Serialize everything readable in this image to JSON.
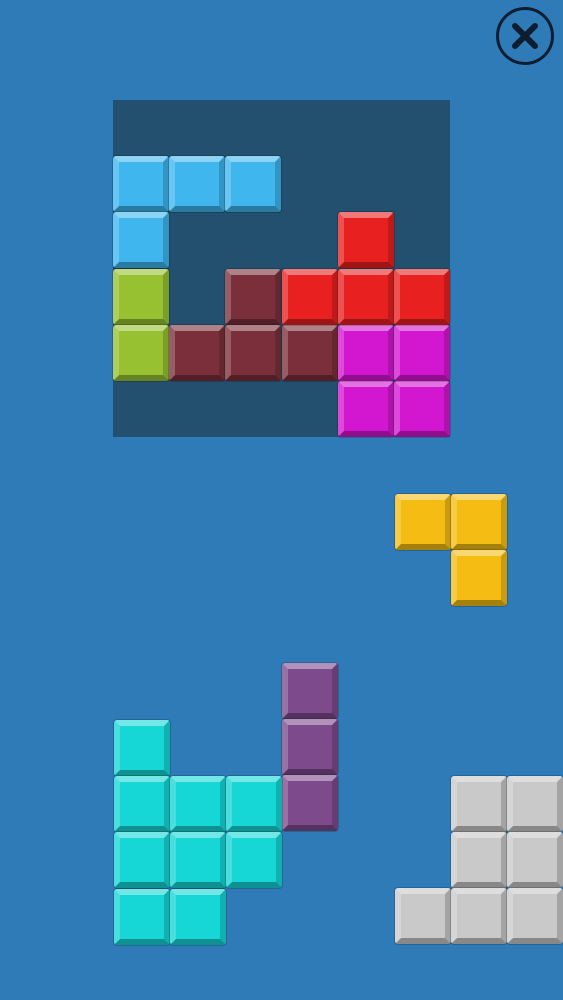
{
  "header": {
    "close_icon": "close-icon"
  },
  "board": {
    "columns": 6,
    "rows": 6,
    "background": "#22506e",
    "cells": [
      {
        "col": 0,
        "row": 1,
        "color": "#3fb6ee"
      },
      {
        "col": 1,
        "row": 1,
        "color": "#3fb6ee"
      },
      {
        "col": 2,
        "row": 1,
        "color": "#3fb6ee"
      },
      {
        "col": 0,
        "row": 2,
        "color": "#3fb6ee"
      },
      {
        "col": 0,
        "row": 3,
        "color": "#97c131"
      },
      {
        "col": 0,
        "row": 4,
        "color": "#97c131"
      },
      {
        "col": 2,
        "row": 3,
        "color": "#7a2f3a"
      },
      {
        "col": 1,
        "row": 4,
        "color": "#7a2f3a"
      },
      {
        "col": 2,
        "row": 4,
        "color": "#7a2f3a"
      },
      {
        "col": 3,
        "row": 4,
        "color": "#7a2f3a"
      },
      {
        "col": 4,
        "row": 5,
        "color": "#d316cf"
      },
      {
        "col": 5,
        "row": 5,
        "color": "#d316cf"
      },
      {
        "col": 4,
        "row": 4,
        "color": "#d316cf"
      },
      {
        "col": 5,
        "row": 4,
        "color": "#d316cf"
      },
      {
        "col": 4,
        "row": 2,
        "color": "#e82020"
      },
      {
        "col": 3,
        "row": 3,
        "color": "#e82020"
      },
      {
        "col": 4,
        "row": 3,
        "color": "#e82020"
      },
      {
        "col": 5,
        "row": 3,
        "color": "#e82020"
      }
    ]
  },
  "tray": {
    "pieces": [
      {
        "name": "yellow-piece",
        "color": "#f5bd14",
        "cells": [
          [
            0,
            0
          ],
          [
            1,
            0
          ],
          [
            1,
            1
          ]
        ]
      },
      {
        "name": "purple-piece",
        "color": "#7d4a8c",
        "cells": [
          [
            0,
            0
          ],
          [
            0,
            1
          ],
          [
            0,
            2
          ]
        ]
      },
      {
        "name": "cyan-piece",
        "color": "#16d6d6",
        "cells": [
          [
            0,
            0
          ],
          [
            0,
            1
          ],
          [
            1,
            1
          ],
          [
            2,
            1
          ],
          [
            0,
            2
          ],
          [
            1,
            2
          ],
          [
            2,
            2
          ],
          [
            0,
            3
          ],
          [
            1,
            3
          ]
        ]
      },
      {
        "name": "gray-piece",
        "color": "#c9c9c9",
        "cells": [
          [
            1,
            0
          ],
          [
            2,
            0
          ],
          [
            1,
            1
          ],
          [
            2,
            1
          ],
          [
            0,
            2
          ],
          [
            1,
            2
          ],
          [
            2,
            2
          ]
        ]
      }
    ]
  }
}
